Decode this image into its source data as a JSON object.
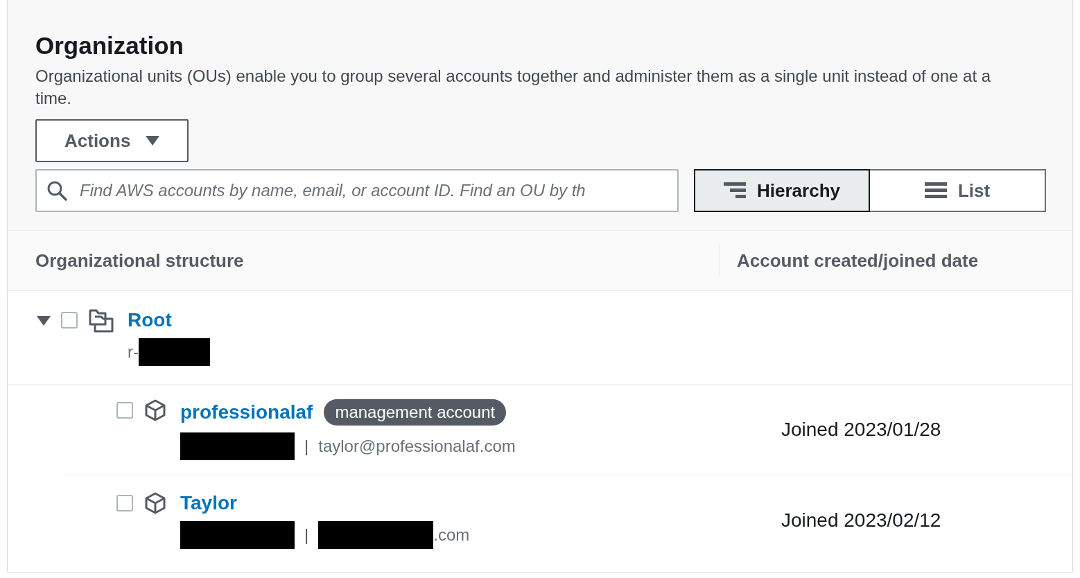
{
  "header": {
    "title": "Organization",
    "description": "Organizational units (OUs) enable you to group several accounts together and administer them as a single unit instead of one at a time."
  },
  "actions_button": {
    "label": "Actions"
  },
  "search": {
    "placeholder": "Find AWS accounts by name, email, or account ID. Find an OU by th"
  },
  "view_toggle": [
    {
      "label": "Hierarchy",
      "kind": "hierarchy",
      "selected": true
    },
    {
      "label": "List",
      "kind": "list",
      "selected": false
    }
  ],
  "table": {
    "columns": [
      "Organizational structure",
      "Account created/joined date"
    ],
    "tree": [
      {
        "kind": "root",
        "name": "Root",
        "id_prefix": "r-",
        "checked": false,
        "expanded": true,
        "children": [
          {
            "kind": "account",
            "name": "professionalaf",
            "badge": "management account",
            "checked": false,
            "separator": "|",
            "email": "taylor@professionalaf.com",
            "date": "Joined 2023/01/28"
          },
          {
            "kind": "account",
            "name": "Taylor",
            "checked": false,
            "separator": "|",
            "email": ".com",
            "email_redacted": true,
            "date": "Joined 2023/02/12"
          }
        ]
      }
    ]
  }
}
